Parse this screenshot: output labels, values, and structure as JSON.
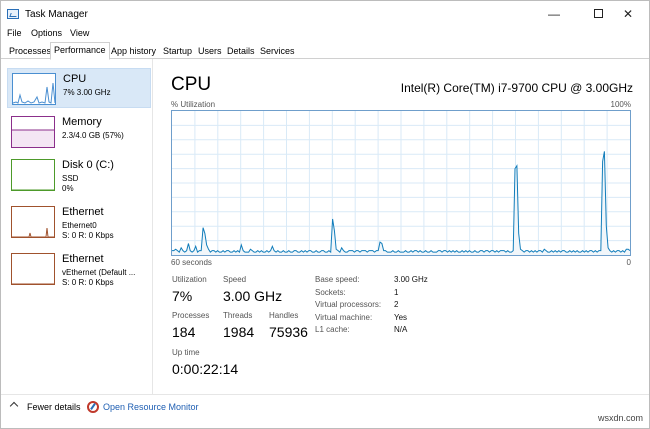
{
  "window": {
    "title": "Task Manager",
    "controls": {
      "minimize": "—",
      "close": "✕"
    }
  },
  "menu": [
    "File",
    "Options",
    "View"
  ],
  "tabs": [
    "Processes",
    "Performance",
    "App history",
    "Startup",
    "Users",
    "Details",
    "Services"
  ],
  "active_tab": "Performance",
  "resources": [
    {
      "name": "CPU",
      "line1": "7% 3.00 GHz",
      "line2": "",
      "color": "#4a8fd1",
      "active": true
    },
    {
      "name": "Memory",
      "line1": "2.3/4.0 GB (57%)",
      "line2": "",
      "color": "#8b2f8b"
    },
    {
      "name": "Disk 0 (C:)",
      "line1": "SSD",
      "line2": "0%",
      "color": "#4d9a2a"
    },
    {
      "name": "Ethernet",
      "line1": "Ethernet0",
      "line2": "S: 0 R: 0 Kbps",
      "color": "#a0522d"
    },
    {
      "name": "Ethernet",
      "line1": "vEthernet (Default ...",
      "line2": "S: 0 R: 0 Kbps",
      "color": "#a0522d"
    }
  ],
  "main": {
    "title": "CPU",
    "model": "Intel(R) Core(TM) i7-9700 CPU @ 3.00GHz",
    "graph": {
      "ylabel": "% Utilization",
      "ymax_label": "100%",
      "xlabel_left": "60 seconds",
      "xlabel_right": "0",
      "color": "#117dbb",
      "fill": "#f1f6fa",
      "values": [
        3,
        3,
        4,
        3,
        2,
        5,
        3,
        2,
        3,
        8,
        3,
        2,
        3,
        6,
        2,
        3,
        3,
        19,
        15,
        7,
        4,
        2,
        3,
        3,
        2,
        3,
        2,
        2,
        3,
        2,
        3,
        3,
        2,
        2,
        3,
        2,
        3,
        2,
        7,
        3,
        2,
        2,
        2,
        4,
        3,
        2,
        2,
        3,
        2,
        3,
        2,
        2,
        3,
        2,
        3,
        6,
        3,
        2,
        3,
        2,
        2,
        3,
        2,
        2,
        3,
        2,
        2,
        3,
        3,
        2,
        2,
        3,
        2,
        3,
        2,
        3,
        3,
        2,
        2,
        3,
        2,
        2,
        3,
        3,
        2,
        2,
        3,
        2,
        25,
        17,
        4,
        3,
        2,
        5,
        3,
        2,
        2,
        3,
        3,
        3,
        2,
        3,
        3,
        2,
        3,
        3,
        3,
        2,
        3,
        3,
        3,
        2,
        3,
        3,
        9,
        8,
        3,
        3,
        2,
        2,
        2,
        3,
        2,
        2,
        3,
        2,
        2,
        2,
        3,
        2,
        2,
        3,
        2,
        3,
        3,
        2,
        3,
        2,
        2,
        3,
        2,
        2,
        3,
        2,
        2,
        2,
        3,
        3,
        2,
        3,
        3,
        2,
        3,
        2,
        3,
        2,
        3,
        2,
        2,
        3,
        2,
        3,
        2,
        3,
        2,
        2,
        3,
        2,
        2,
        3,
        3,
        2,
        3,
        3,
        2,
        3,
        3,
        2,
        3,
        2,
        3,
        3,
        3,
        2,
        3,
        2,
        2,
        3,
        60,
        62,
        15,
        4,
        3,
        2,
        3,
        3,
        2,
        3,
        2,
        3,
        2,
        3,
        3,
        2,
        4,
        3,
        2,
        2,
        3,
        2,
        3,
        2,
        3,
        2,
        3,
        3,
        2,
        2,
        3,
        2,
        3,
        2,
        3,
        2,
        2,
        3,
        2,
        3,
        2,
        3,
        3,
        2,
        3,
        2,
        3,
        3,
        65,
        72,
        20,
        5,
        3,
        2,
        3,
        2,
        3,
        3,
        2,
        3,
        2,
        4,
        4,
        3
      ]
    },
    "stats": {
      "utilization": {
        "label": "Utilization",
        "value": "7%"
      },
      "speed": {
        "label": "Speed",
        "value": "3.00 GHz"
      },
      "processes": {
        "label": "Processes",
        "value": "184"
      },
      "threads": {
        "label": "Threads",
        "value": "1984"
      },
      "handles": {
        "label": "Handles",
        "value": "75936"
      },
      "uptime": {
        "label": "Up time",
        "value": "0:00:22:14"
      }
    },
    "specs": [
      {
        "key": "Base speed:",
        "value": "3.00 GHz"
      },
      {
        "key": "Sockets:",
        "value": "1"
      },
      {
        "key": "Virtual processors:",
        "value": "2"
      },
      {
        "key": "Virtual machine:",
        "value": "Yes"
      },
      {
        "key": "L1 cache:",
        "value": "N/A"
      }
    ]
  },
  "footer": {
    "fewer_details": "Fewer details",
    "open_resource_monitor": "Open Resource Monitor",
    "watermark": "wsxdn.com"
  }
}
